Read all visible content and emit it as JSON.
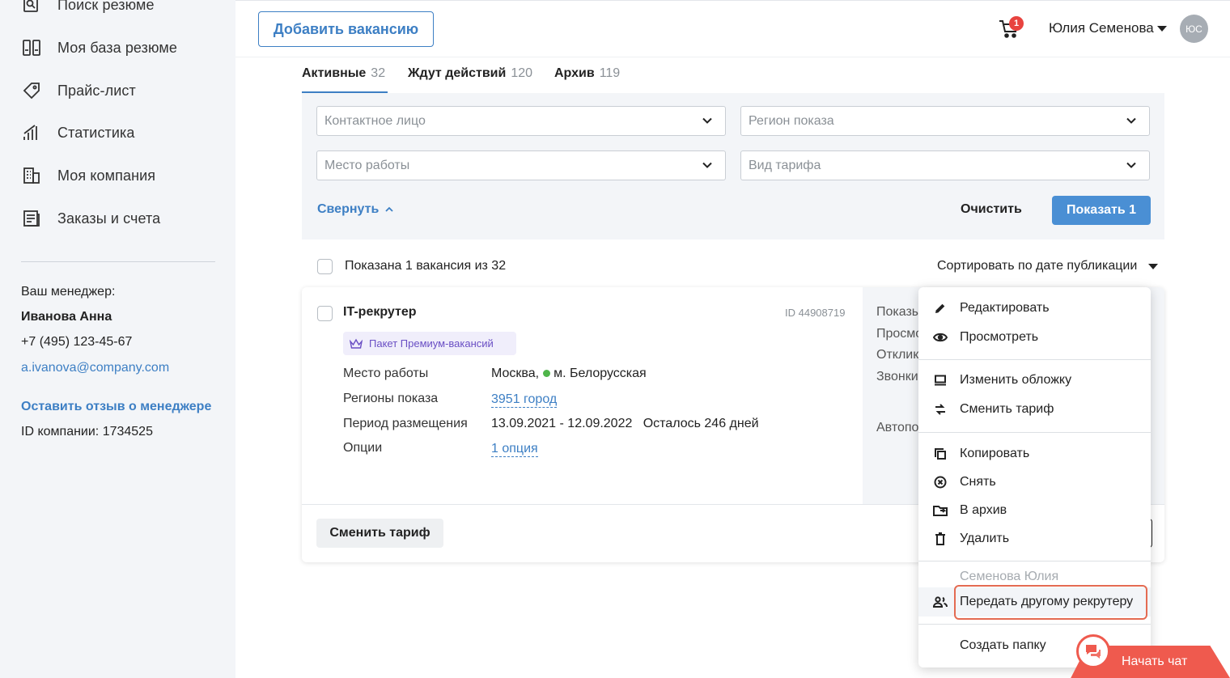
{
  "sidebar": {
    "items": [
      {
        "label": "Поиск резюме",
        "icon": "search-resume-icon"
      },
      {
        "label": "Моя база резюме",
        "icon": "resume-base-icon"
      },
      {
        "label": "Прайс-лист",
        "icon": "price-tag-icon"
      },
      {
        "label": "Статистика",
        "icon": "statistics-icon"
      },
      {
        "label": "Моя компания",
        "icon": "company-building-icon"
      },
      {
        "label": "Заказы и счета",
        "icon": "orders-icon"
      }
    ],
    "manager": {
      "caption": "Ваш менеджер:",
      "name": "Иванова Анна",
      "phone": "+7 (495) 123-45-67",
      "email": "a.ivanova@company.com",
      "feedback_link": "Оставить отзыв о менеджере",
      "company_id": "ID компании: 1734525"
    }
  },
  "header": {
    "add_vacancy": "Добавить вакансию",
    "cart_count": "1",
    "user_name": "Юлия Семенова",
    "avatar_initials": "ЮС"
  },
  "tabs": [
    {
      "label": "Активные",
      "count": "32"
    },
    {
      "label": "Ждут действий",
      "count": "120"
    },
    {
      "label": "Архив",
      "count": "119"
    }
  ],
  "filters": {
    "contact_person": "Контактное лицо",
    "region": "Регион показа",
    "workplace": "Место работы",
    "tariff": "Вид тарифа",
    "collapse": "Свернуть",
    "clear": "Очистить",
    "show": "Показать 1"
  },
  "list": {
    "shown": "Показана 1 вакансия из 32",
    "sort": "Сортировать по дате публикации"
  },
  "vacancy": {
    "title": "IT-рекрутер",
    "id": "ID 44908719",
    "package": "Пакет Премиум-вакансий",
    "workplace_label": "Место работы",
    "workplace_city": "Москва,",
    "workplace_metro": "м. Белорусская",
    "regions_label": "Регионы показа",
    "regions_value": "3951 город",
    "period_label": "Период размещения",
    "period_value": "13.09.2021 - 12.09.2022   Осталось 246 дней",
    "options_label": "Опции",
    "options_value": "1 опция",
    "side_labels": [
      "Показы",
      "Просмотры",
      "Отклики",
      "Звонки",
      "Автоподнятие"
    ],
    "change_tariff": "Сменить тариф"
  },
  "menu": {
    "edit": "Редактировать",
    "view": "Просмотреть",
    "change_cover": "Изменить обложку",
    "change_tariff": "Сменить тариф",
    "copy": "Копировать",
    "withdraw": "Снять",
    "archive": "В архив",
    "delete": "Удалить",
    "owner": "Семенова Юлия",
    "transfer": "Передать другому рекрутеру",
    "create_folder": "Создать папку"
  },
  "chat": {
    "label": "Начать чат"
  },
  "colors": {
    "accent": "#3d7fc4",
    "primary_button": "#4a8fd4",
    "badge": "#e8433f",
    "chat": "#ef5a4e",
    "highlight": "#e46b52",
    "metro": "#4fb54a"
  }
}
